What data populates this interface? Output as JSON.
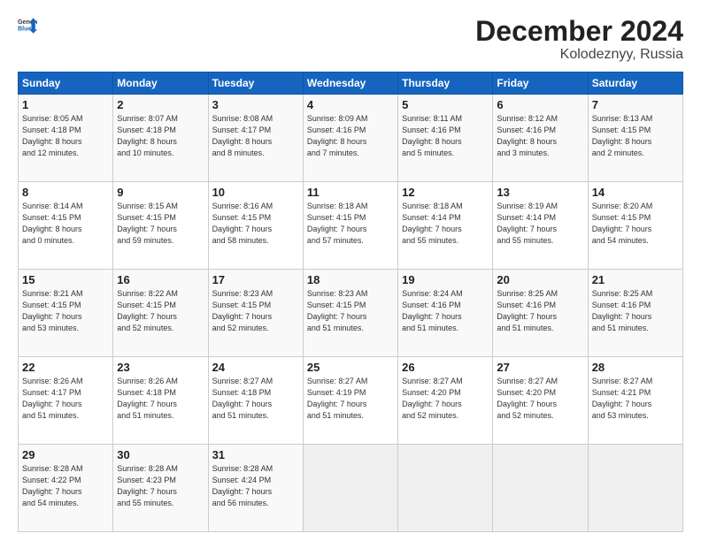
{
  "header": {
    "logo_general": "General",
    "logo_blue": "Blue",
    "month_title": "December 2024",
    "subtitle": "Kolodeznyy, Russia"
  },
  "days_of_week": [
    "Sunday",
    "Monday",
    "Tuesday",
    "Wednesday",
    "Thursday",
    "Friday",
    "Saturday"
  ],
  "weeks": [
    [
      {
        "day": "1",
        "sunrise": "8:05 AM",
        "sunset": "4:18 PM",
        "daylight": "8 hours",
        "minutes": "12 minutes."
      },
      {
        "day": "2",
        "sunrise": "8:07 AM",
        "sunset": "4:18 PM",
        "daylight": "8 hours",
        "minutes": "10 minutes."
      },
      {
        "day": "3",
        "sunrise": "8:08 AM",
        "sunset": "4:17 PM",
        "daylight": "8 hours",
        "minutes": "8 minutes."
      },
      {
        "day": "4",
        "sunrise": "8:09 AM",
        "sunset": "4:16 PM",
        "daylight": "8 hours",
        "minutes": "7 minutes."
      },
      {
        "day": "5",
        "sunrise": "8:11 AM",
        "sunset": "4:16 PM",
        "daylight": "8 hours",
        "minutes": "5 minutes."
      },
      {
        "day": "6",
        "sunrise": "8:12 AM",
        "sunset": "4:16 PM",
        "daylight": "8 hours",
        "minutes": "3 minutes."
      },
      {
        "day": "7",
        "sunrise": "8:13 AM",
        "sunset": "4:15 PM",
        "daylight": "8 hours",
        "minutes": "2 minutes."
      }
    ],
    [
      {
        "day": "8",
        "sunrise": "8:14 AM",
        "sunset": "4:15 PM",
        "daylight": "8 hours",
        "minutes": "0 minutes."
      },
      {
        "day": "9",
        "sunrise": "8:15 AM",
        "sunset": "4:15 PM",
        "daylight": "7 hours",
        "minutes": "59 minutes."
      },
      {
        "day": "10",
        "sunrise": "8:16 AM",
        "sunset": "4:15 PM",
        "daylight": "7 hours",
        "minutes": "58 minutes."
      },
      {
        "day": "11",
        "sunrise": "8:18 AM",
        "sunset": "4:15 PM",
        "daylight": "7 hours",
        "minutes": "57 minutes."
      },
      {
        "day": "12",
        "sunrise": "8:18 AM",
        "sunset": "4:14 PM",
        "daylight": "7 hours",
        "minutes": "55 minutes."
      },
      {
        "day": "13",
        "sunrise": "8:19 AM",
        "sunset": "4:14 PM",
        "daylight": "7 hours",
        "minutes": "55 minutes."
      },
      {
        "day": "14",
        "sunrise": "8:20 AM",
        "sunset": "4:15 PM",
        "daylight": "7 hours",
        "minutes": "54 minutes."
      }
    ],
    [
      {
        "day": "15",
        "sunrise": "8:21 AM",
        "sunset": "4:15 PM",
        "daylight": "7 hours",
        "minutes": "53 minutes."
      },
      {
        "day": "16",
        "sunrise": "8:22 AM",
        "sunset": "4:15 PM",
        "daylight": "7 hours",
        "minutes": "52 minutes."
      },
      {
        "day": "17",
        "sunrise": "8:23 AM",
        "sunset": "4:15 PM",
        "daylight": "7 hours",
        "minutes": "52 minutes."
      },
      {
        "day": "18",
        "sunrise": "8:23 AM",
        "sunset": "4:15 PM",
        "daylight": "7 hours",
        "minutes": "51 minutes."
      },
      {
        "day": "19",
        "sunrise": "8:24 AM",
        "sunset": "4:16 PM",
        "daylight": "7 hours",
        "minutes": "51 minutes."
      },
      {
        "day": "20",
        "sunrise": "8:25 AM",
        "sunset": "4:16 PM",
        "daylight": "7 hours",
        "minutes": "51 minutes."
      },
      {
        "day": "21",
        "sunrise": "8:25 AM",
        "sunset": "4:16 PM",
        "daylight": "7 hours",
        "minutes": "51 minutes."
      }
    ],
    [
      {
        "day": "22",
        "sunrise": "8:26 AM",
        "sunset": "4:17 PM",
        "daylight": "7 hours",
        "minutes": "51 minutes."
      },
      {
        "day": "23",
        "sunrise": "8:26 AM",
        "sunset": "4:18 PM",
        "daylight": "7 hours",
        "minutes": "51 minutes."
      },
      {
        "day": "24",
        "sunrise": "8:27 AM",
        "sunset": "4:18 PM",
        "daylight": "7 hours",
        "minutes": "51 minutes."
      },
      {
        "day": "25",
        "sunrise": "8:27 AM",
        "sunset": "4:19 PM",
        "daylight": "7 hours",
        "minutes": "51 minutes."
      },
      {
        "day": "26",
        "sunrise": "8:27 AM",
        "sunset": "4:20 PM",
        "daylight": "7 hours",
        "minutes": "52 minutes."
      },
      {
        "day": "27",
        "sunrise": "8:27 AM",
        "sunset": "4:20 PM",
        "daylight": "7 hours",
        "minutes": "52 minutes."
      },
      {
        "day": "28",
        "sunrise": "8:27 AM",
        "sunset": "4:21 PM",
        "daylight": "7 hours",
        "minutes": "53 minutes."
      }
    ],
    [
      {
        "day": "29",
        "sunrise": "8:28 AM",
        "sunset": "4:22 PM",
        "daylight": "7 hours",
        "minutes": "54 minutes."
      },
      {
        "day": "30",
        "sunrise": "8:28 AM",
        "sunset": "4:23 PM",
        "daylight": "7 hours",
        "minutes": "55 minutes."
      },
      {
        "day": "31",
        "sunrise": "8:28 AM",
        "sunset": "4:24 PM",
        "daylight": "7 hours",
        "minutes": "56 minutes."
      },
      null,
      null,
      null,
      null
    ]
  ]
}
